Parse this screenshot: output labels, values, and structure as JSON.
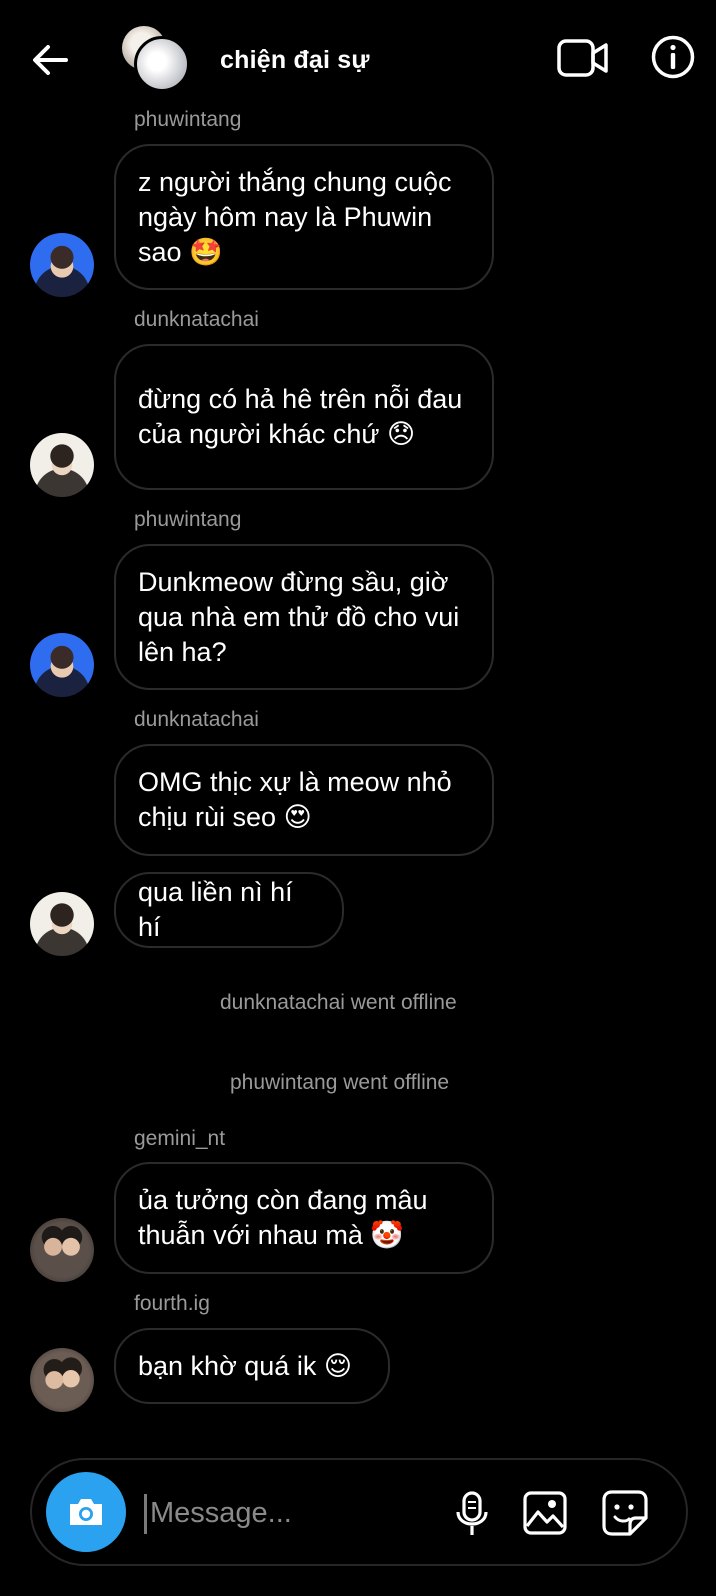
{
  "header": {
    "title": "chiện đại sự",
    "back_icon": "arrow-left-icon",
    "video_icon": "video-camera-icon",
    "info_icon": "info-icon"
  },
  "messages": [
    {
      "sender": "phuwintang",
      "text": "z người thắng chung cuộc ngày hôm nay là Phuwin sao 🤩"
    },
    {
      "sender": "dunknatachai",
      "text": "đừng có hả hê trên nỗi đau của người khác chứ 😞"
    },
    {
      "sender": "phuwintang",
      "text": "Dunkmeow đừng sầu, giờ qua nhà em thử đồ cho vui lên ha?"
    },
    {
      "sender": "dunknatachai",
      "text": "OMG thịc xự là meow nhỏ chịu rùi seo 😍"
    },
    {
      "sender": "",
      "text": "qua liền nì hí hí"
    },
    {
      "sender": "gemini_nt",
      "text": "ủa tưởng còn đang mâu thuẫn với nhau mà 🤡"
    },
    {
      "sender": "fourth.ig",
      "text": "bạn khờ quá ik 😌"
    }
  ],
  "status_events": [
    "dunknatachai went offline",
    "phuwintang went offline"
  ],
  "composer": {
    "placeholder": "Message...",
    "camera_icon": "camera-icon",
    "mic_icon": "microphone-icon",
    "gallery_icon": "image-gallery-icon",
    "sticker_icon": "sticker-icon"
  },
  "colors": {
    "background": "#000000",
    "bubble_border": "#2b2b2b",
    "meta_text": "#9a9a9a",
    "camera_accent": "#2ba2f0"
  }
}
